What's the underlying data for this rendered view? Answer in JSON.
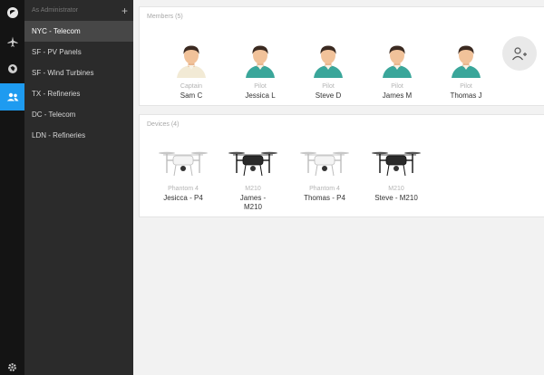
{
  "sidebar": {
    "header_title": "As Administrator",
    "add_label": "+",
    "groups": [
      {
        "label": "NYC - Telecom",
        "active": true
      },
      {
        "label": "SF - PV Panels"
      },
      {
        "label": "SF - Wind Turbines"
      },
      {
        "label": "TX - Refineries"
      },
      {
        "label": "DC - Telecom"
      },
      {
        "label": "LDN - Refineries"
      }
    ]
  },
  "rail": {
    "icons": [
      "logo-icon",
      "flight-icon",
      "map-pin-icon",
      "team-icon",
      "settings-icon"
    ],
    "active": "team-icon",
    "active_color": "#1e9bf0"
  },
  "members": {
    "title": "Members (5)",
    "items": [
      {
        "role": "Captain",
        "name": "Sam C",
        "shirt": "#f2ead5"
      },
      {
        "role": "Pilot",
        "name": "Jessica L",
        "shirt": "#3aa69a"
      },
      {
        "role": "Pilot",
        "name": "Steve D",
        "shirt": "#3aa69a"
      },
      {
        "role": "Pilot",
        "name": "James M",
        "shirt": "#3aa69a"
      },
      {
        "role": "Pilot",
        "name": "Thomas J",
        "shirt": "#3aa69a"
      }
    ]
  },
  "devices": {
    "title": "Devices (4)",
    "items": [
      {
        "model": "Phantom 4",
        "name": "Jesicca - P4",
        "color": "white"
      },
      {
        "model": "M210",
        "name": "James - M210",
        "color": "black"
      },
      {
        "model": "Phantom 4",
        "name": "Thomas - P4",
        "color": "white"
      },
      {
        "model": "M210",
        "name": "Steve - M210",
        "color": "black"
      }
    ]
  }
}
